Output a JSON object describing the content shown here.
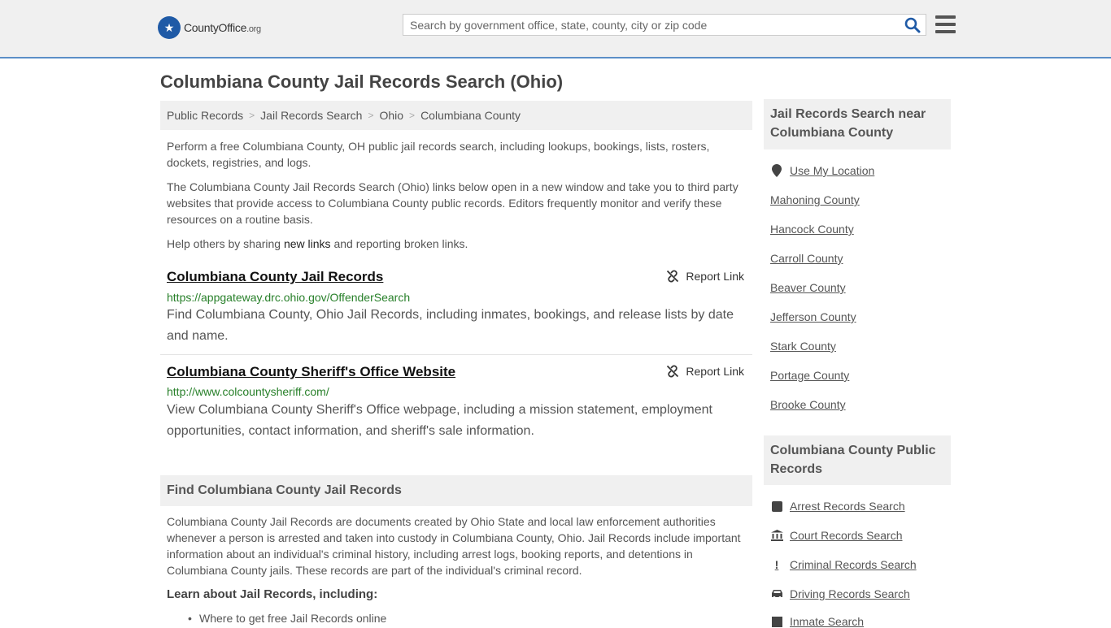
{
  "header": {
    "logo_main": "CountyOffice",
    "logo_tld": ".org",
    "search_placeholder": "Search by government office, state, county, city or zip code"
  },
  "page_title": "Columbiana County Jail Records Search (Ohio)",
  "breadcrumb": [
    "Public Records",
    "Jail Records Search",
    "Ohio",
    "Columbiana County"
  ],
  "intro": {
    "p1": "Perform a free Columbiana County, OH public jail records search, including lookups, bookings, lists, rosters, dockets, registries, and logs.",
    "p2": "The Columbiana County Jail Records Search (Ohio) links below open in a new window and take you to third party websites that provide access to Columbiana County public records. Editors frequently monitor and verify these resources on a routine basis.",
    "p3_before": "Help others by sharing ",
    "p3_link": "new links",
    "p3_after": " and reporting broken links."
  },
  "results": [
    {
      "title": "Columbiana County Jail Records",
      "url": "https://appgateway.drc.ohio.gov/OffenderSearch",
      "description": "Find Columbiana County, Ohio Jail Records, including inmates, bookings, and release lists by date and name.",
      "report_label": "Report Link"
    },
    {
      "title": "Columbiana County Sheriff's Office Website",
      "url": "http://www.colcountysheriff.com/",
      "description": "View Columbiana County Sheriff's Office webpage, including a mission statement, employment opportunities, contact information, and sheriff's sale information.",
      "report_label": "Report Link"
    }
  ],
  "find_section": {
    "heading": "Find Columbiana County Jail Records",
    "text": "Columbiana County Jail Records are documents created by Ohio State and local law enforcement authorities whenever a person is arrested and taken into custody in Columbiana County, Ohio. Jail Records include important information about an individual's criminal history, including arrest logs, booking reports, and detentions in Columbiana County jails. These records are part of the individual's criminal record.",
    "learn_heading": "Learn about Jail Records, including:",
    "learn_items": [
      "Where to get free Jail Records online"
    ]
  },
  "sidebar": {
    "nearby_heading": "Jail Records Search near Columbiana County",
    "use_location": "Use My Location",
    "nearby": [
      "Mahoning County",
      "Hancock County",
      "Carroll County",
      "Beaver County",
      "Jefferson County",
      "Stark County",
      "Portage County",
      "Brooke County"
    ],
    "public_heading": "Columbiana County Public Records",
    "public_links": [
      {
        "label": "Arrest Records Search",
        "icon": "square-icon"
      },
      {
        "label": "Court Records Search",
        "icon": "courthouse-icon"
      },
      {
        "label": "Criminal Records Search",
        "icon": "exclamation-icon"
      },
      {
        "label": "Driving Records Search",
        "icon": "car-icon"
      },
      {
        "label": "Inmate Search",
        "icon": "inmate-icon"
      }
    ]
  }
}
